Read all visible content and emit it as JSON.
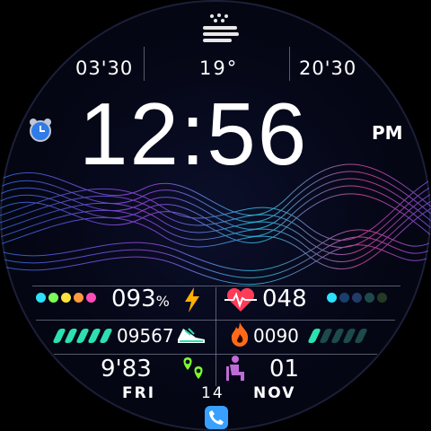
{
  "weather": {
    "icon": "fog-rain-icon",
    "temperature": "19°"
  },
  "sun": {
    "sunrise": "03'30",
    "sunset": "20'30"
  },
  "time": {
    "clock": "12:56",
    "ampm": "PM"
  },
  "alarm": {
    "icon": "alarm-clock-icon"
  },
  "battery": {
    "value": "093",
    "unit": "%",
    "icon": "lightning-bolt-icon",
    "dot_colors": [
      "#2ce0ff",
      "#7cff5a",
      "#ffe23d",
      "#ff9a3d",
      "#ff4db8"
    ]
  },
  "heart": {
    "value": "048",
    "icon": "heart-pulse-icon",
    "dot_colors": [
      "#2ce0ff",
      "#1b3f6a",
      "#203c66",
      "#1d4a4a",
      "#243a24"
    ]
  },
  "steps": {
    "value": "09567",
    "icon": "running-shoe-icon",
    "stripe_color": "#2de0b0"
  },
  "calories": {
    "value": "0090",
    "icon": "flame-icon",
    "stripe_color": "#2de0b0"
  },
  "distance": {
    "value": "9'83",
    "icon": "location-pins-icon"
  },
  "stand": {
    "value": "01",
    "icon": "person-sitting-icon"
  },
  "date": {
    "weekday": "FRI",
    "day": "14",
    "month": "NOV"
  },
  "phone": {
    "icon": "phone-icon"
  },
  "colors": {
    "accent_cyan": "#2ce0ff",
    "accent_pink": "#ff4db8",
    "bolt": "#ffb000",
    "heart": "#ff3b57"
  }
}
